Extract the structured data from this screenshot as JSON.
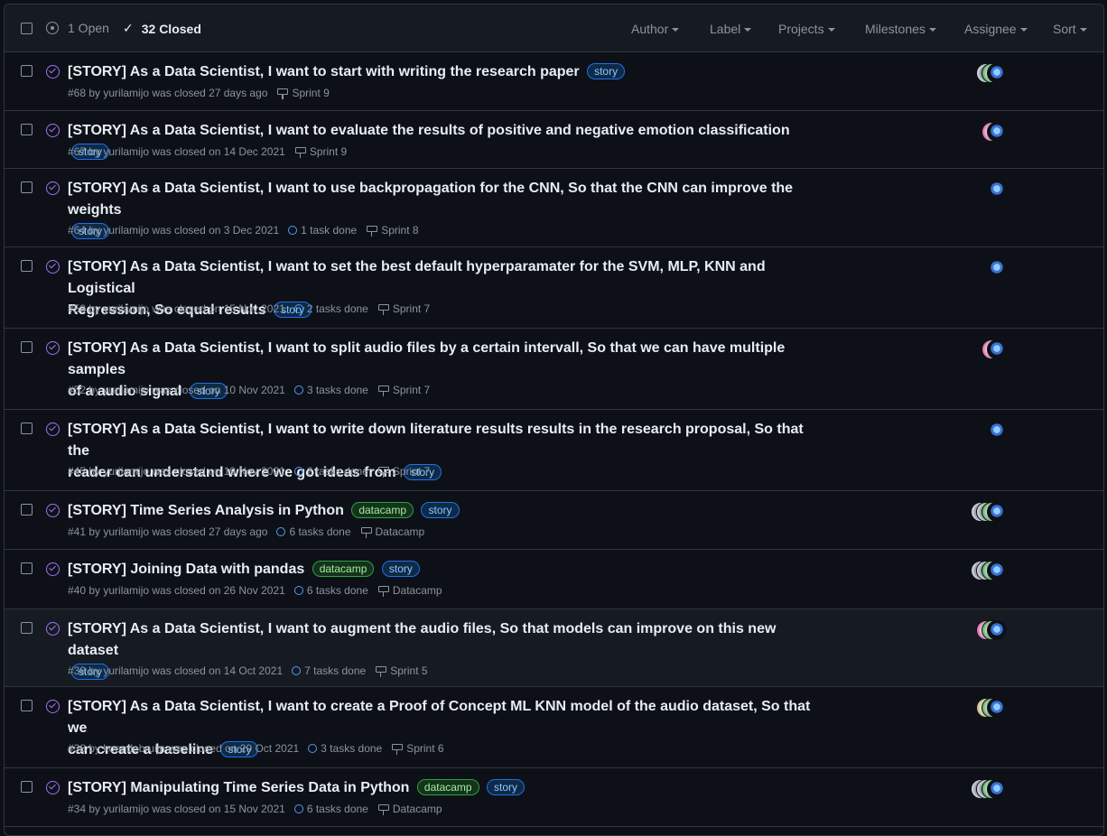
{
  "header": {
    "open_count": "1 Open",
    "closed_count": "32 Closed",
    "filters": [
      "Author",
      "Label",
      "Projects",
      "Milestones",
      "Assignee",
      "Sort"
    ]
  },
  "issues": [
    {
      "title": "[STORY] As a Data Scientist, I want to start with writing the research paper",
      "labels": [
        "story"
      ],
      "meta": "#68 by yurilamijo was closed 27 days ago",
      "tasks": "",
      "milestone": "Sprint 9",
      "avatars": [
        "gray",
        "green",
        "main"
      ]
    },
    {
      "title": "[STORY] As a Data Scientist, I want to evaluate the results of positive and negative emotion classification",
      "labels": [
        "story"
      ],
      "meta": "#67 by yurilamijo was closed on 14 Dec 2021",
      "tasks": "",
      "milestone": "Sprint 9",
      "avatars": [
        "pink",
        "main"
      ]
    },
    {
      "title": "[STORY] As a Data Scientist, I want to use backpropagation for the CNN, So that the CNN can improve the weights",
      "labels": [
        "story"
      ],
      "meta": "#64 by yurilamijo was closed on 3 Dec 2021",
      "tasks": "1 task done",
      "milestone": "Sprint 8",
      "avatars": [
        "main"
      ]
    },
    {
      "title": "[STORY] As a Data Scientist, I want to set the best default hyperparamater for the SVM, MLP, KNN and Logistical Regression, So equal results",
      "labels": [
        "story"
      ],
      "meta": "#58 by yurilamijo was closed on 15 Nov 2021",
      "tasks": "2 tasks done",
      "milestone": "Sprint 7",
      "avatars": [
        "main"
      ]
    },
    {
      "title": "[STORY] As a Data Scientist, I want to split audio files by a certain intervall, So that we can have multiple samples of a audio signal",
      "labels": [
        "story"
      ],
      "meta": "#52 by yurilamijo was closed on 10 Nov 2021",
      "tasks": "3 tasks done",
      "milestone": "Sprint 7",
      "avatars": [
        "pink",
        "main"
      ]
    },
    {
      "title": "[STORY] As a Data Scientist, I want to write down literature results results in the research proposal, So that the reader can understand where we got ideas from",
      "labels": [
        "story"
      ],
      "meta": "#45 by yurilamijo was closed on 19 Nov 2021",
      "tasks": "2 tasks done",
      "milestone": "Sprint 7",
      "avatars": [
        "main"
      ]
    },
    {
      "title": "[STORY] Time Series Analysis in Python",
      "labels": [
        "datacamp",
        "story"
      ],
      "meta": "#41 by yurilamijo was closed 27 days ago",
      "tasks": "6 tasks done",
      "milestone": "Datacamp",
      "avatars": [
        "gray",
        "gray",
        "green",
        "main"
      ]
    },
    {
      "title": "[STORY] Joining Data with pandas",
      "labels": [
        "datacamp",
        "story"
      ],
      "meta": "#40 by yurilamijo was closed on 26 Nov 2021",
      "tasks": "6 tasks done",
      "milestone": "Datacamp",
      "avatars": [
        "gray",
        "gray",
        "green",
        "main"
      ]
    },
    {
      "title": "[STORY] As a Data Scientist, I want to augment the audio files, So that models can improve on this new dataset",
      "labels": [
        "story"
      ],
      "meta": "#39 by yurilamijo was closed on 14 Oct 2021",
      "tasks": "7 tasks done",
      "milestone": "Sprint 5",
      "avatars": [
        "pink",
        "green",
        "main"
      ]
    },
    {
      "title": "[STORY] As a Data Scientist, I want to create a Proof of Concept ML KNN model of the audio dataset, So that we can create a baseline",
      "labels": [
        "story"
      ],
      "meta": "#38 by koendebruijn was closed on 29 Oct 2021",
      "tasks": "3 tasks done",
      "milestone": "Sprint 6",
      "avatars": [
        "tan",
        "green",
        "main"
      ]
    },
    {
      "title": "[STORY] Manipulating Time Series Data in Python",
      "labels": [
        "datacamp",
        "story"
      ],
      "meta": "#34 by yurilamijo was closed on 15 Nov 2021",
      "tasks": "6 tasks done",
      "milestone": "Datacamp",
      "avatars": [
        "gray",
        "gray",
        "green",
        "main"
      ]
    }
  ]
}
